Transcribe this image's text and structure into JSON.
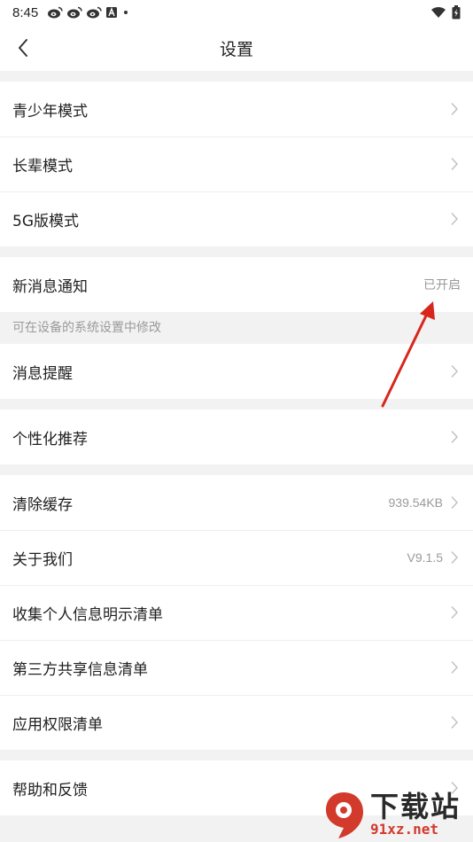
{
  "status_bar": {
    "time": "8:45",
    "left_icons": [
      "weibo-icon",
      "weibo-icon",
      "weibo-icon",
      "a-notification-icon",
      "dot-icon"
    ],
    "right_icons": [
      "wifi-icon",
      "battery-icon"
    ]
  },
  "nav": {
    "title": "设置",
    "back_icon": "chevron-left-icon"
  },
  "groups": [
    {
      "items": [
        {
          "label": "青少年模式",
          "value": ""
        },
        {
          "label": "长辈模式",
          "value": ""
        },
        {
          "label": "5G版模式",
          "value": ""
        }
      ]
    },
    {
      "items": [
        {
          "label": "新消息通知",
          "value": "已开启"
        }
      ]
    },
    {
      "hint": "可在设备的系统设置中修改"
    },
    {
      "items": [
        {
          "label": "消息提醒",
          "value": ""
        }
      ]
    },
    {
      "items": [
        {
          "label": "个性化推荐",
          "value": ""
        }
      ]
    },
    {
      "items": [
        {
          "label": "清除缓存",
          "value": "939.54KB"
        },
        {
          "label": "关于我们",
          "value": "V9.1.5"
        },
        {
          "label": "收集个人信息明示清单",
          "value": ""
        },
        {
          "label": "第三方共享信息清单",
          "value": ""
        },
        {
          "label": "应用权限清单",
          "value": ""
        }
      ]
    },
    {
      "items": [
        {
          "label": "帮助和反馈",
          "value": ""
        }
      ]
    }
  ],
  "annotation": {
    "color": "#d9261c"
  },
  "watermark": {
    "big": "下载站",
    "small": "91xz.net",
    "color": "#d23a2c"
  }
}
